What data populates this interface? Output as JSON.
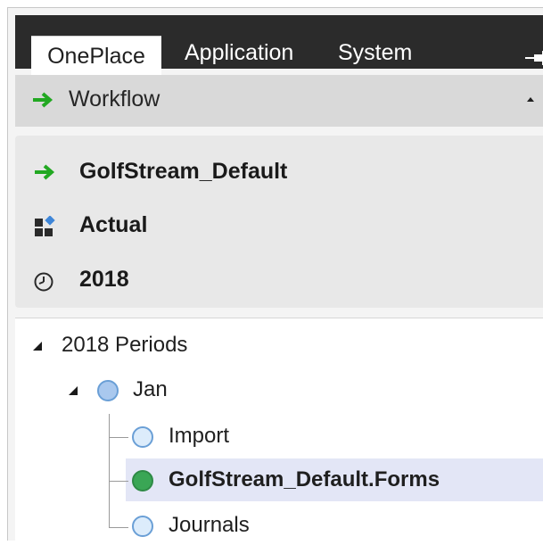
{
  "tabs": [
    {
      "label": "OnePlace",
      "active": true
    },
    {
      "label": "Application",
      "active": false
    },
    {
      "label": "System",
      "active": false
    }
  ],
  "pin_icon": "pin-icon",
  "workflow": {
    "title": "Workflow",
    "arrow_color": "#22a822"
  },
  "pov": {
    "workflow_name": "GolfStream_Default",
    "scenario": "Actual",
    "time": "2018"
  },
  "tree": {
    "root": "2018 Periods",
    "period": "Jan",
    "children": [
      {
        "label": "Import",
        "status": "pending"
      },
      {
        "label": "GolfStream_Default.Forms",
        "status": "complete",
        "selected": true
      },
      {
        "label": "Journals",
        "status": "pending"
      }
    ]
  },
  "colors": {
    "tabbar_bg": "#2b2b2b",
    "selected_row": "#e3e6f6",
    "complete": "#3aa655",
    "pending": "#dcecfb"
  }
}
